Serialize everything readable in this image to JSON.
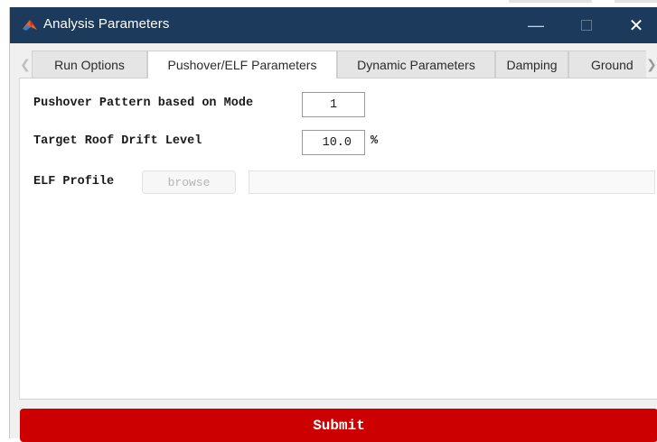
{
  "window": {
    "title": "Analysis Parameters",
    "icons": {
      "app": "matlab-icon",
      "minimize": "minimize-icon",
      "maximize": "maximize-icon",
      "close": "close-icon"
    },
    "titlebar_color": "#1b3a5c"
  },
  "tabs": [
    {
      "label": "Run Options",
      "active": false
    },
    {
      "label": "Pushover/ELF Parameters",
      "active": true
    },
    {
      "label": "Dynamic Parameters",
      "active": false
    },
    {
      "label": "Damping",
      "active": false
    },
    {
      "label": "Ground",
      "active": false
    }
  ],
  "form": {
    "pushover_mode_label": "Pushover Pattern based on Mode",
    "pushover_mode_value": "1",
    "target_drift_label": "Target Roof Drift Level",
    "target_drift_value": "10.0",
    "target_drift_unit": "%",
    "elf_profile_label": "ELF Profile",
    "browse_label": "browse",
    "elf_profile_path": ""
  },
  "submit": {
    "label": "Submit",
    "color": "#cc0000"
  }
}
